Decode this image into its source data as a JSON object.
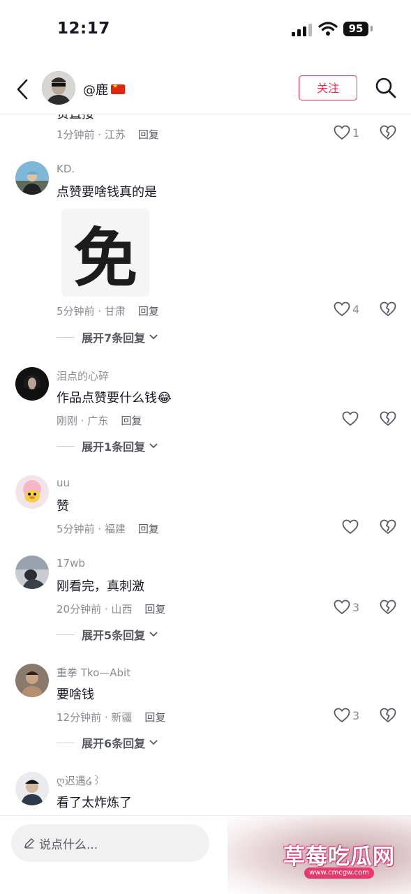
{
  "status": {
    "time": "12:17",
    "battery": "95"
  },
  "header": {
    "username": "@鹿",
    "follow_label": "关注"
  },
  "partial_comment": {
    "text": "赞直接",
    "time": "1分钟前 · 江苏",
    "reply": "回复",
    "likes": "1"
  },
  "comments": [
    {
      "user": "KD.",
      "text": "点赞要啥钱真的是",
      "sticker": "免",
      "time": "5分钟前 · 甘肃",
      "reply": "回复",
      "likes": "4",
      "expand": "展开7条回复"
    },
    {
      "user": "泪点的心碎",
      "text": "作品点赞要什么钱",
      "emoji": "😂",
      "time": "刚刚 · 广东",
      "reply": "回复",
      "likes": "",
      "expand": "展开1条回复"
    },
    {
      "user": "uu",
      "text": "赞",
      "time": "5分钟前 · 福建",
      "reply": "回复",
      "likes": ""
    },
    {
      "user": "17wb",
      "text": "刚看完，真刺激",
      "time": "20分钟前 · 山西",
      "reply": "回复",
      "likes": "3",
      "expand": "展开5条回复"
    },
    {
      "user": "重拳 Tko—Abit",
      "text": "要啥钱",
      "time": "12分钟前 · 新疆",
      "reply": "回复",
      "likes": "3",
      "expand": "展开6条回复"
    },
    {
      "user": "ღ迟遇໒꒱",
      "text": "看了太炸炼了"
    }
  ],
  "bottom": {
    "placeholder": "说点什么...",
    "watermark": "草莓吃瓜网",
    "watermark_url": "www.cmcgw.com"
  }
}
